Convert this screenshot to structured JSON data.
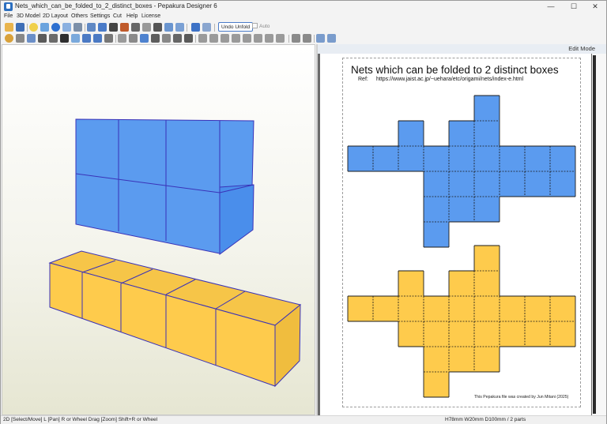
{
  "window": {
    "title": "Nets_which_can_be_folded_to_2_distinct_boxes - Pepakura Designer 6",
    "minimize_glyph": "—",
    "maximize_glyph": "☐",
    "close_glyph": "✕"
  },
  "menu": {
    "items": [
      "File",
      "3D Model",
      "2D Layout",
      "Others",
      "Settings",
      "Cut",
      "Help",
      "License"
    ]
  },
  "toolbar": {
    "undo_unfold_label": "Undo Unfold",
    "auto_label": "Auto"
  },
  "pane2d": {
    "mode_label": "Edit Mode"
  },
  "document": {
    "title": "Nets which can be folded to 2 distinct boxes",
    "ref_label": "Ref:",
    "ref_url": "https://www.jaist.ac.jp/~uehara/etc/origami/nets/index-e.html",
    "credit": "This Pepakura file was created by Jun Mitani (2025)"
  },
  "statusbar": {
    "left": "2D [Select/Move] L [Pan] R or Wheel Drag [Zoom] Shift+R or Wheel",
    "right": "H78mm W20mm D100mm / 2 parts"
  },
  "colors": {
    "blue_box": "#5b9bef",
    "yellow_box": "#fecb4c",
    "edge": "#3a32b8",
    "net_outline": "#1b1b1b"
  }
}
